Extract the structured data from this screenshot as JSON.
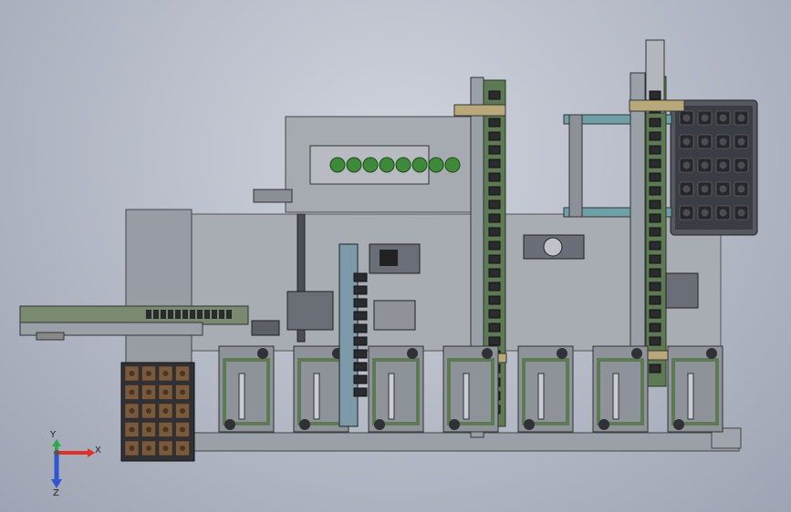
{
  "triad": {
    "x_label": "X",
    "y_label": "Y",
    "z_label": "Z",
    "x_color": "#e0302a",
    "y_color": "#2fa84a",
    "z_color": "#2f55d4"
  },
  "colors": {
    "frame": "#8f939b",
    "frame_dark": "#5a5e66",
    "plate": "#a9adb4",
    "rail_green": "#5f7a55",
    "rail_green_dark": "#3c4f36",
    "bracket_tan": "#b9a97a",
    "tray_green": "#3f8a3a",
    "tray_brown": "#7a5a3c",
    "tray_dark": "#33363c",
    "cable_black": "#2a2b2e"
  }
}
